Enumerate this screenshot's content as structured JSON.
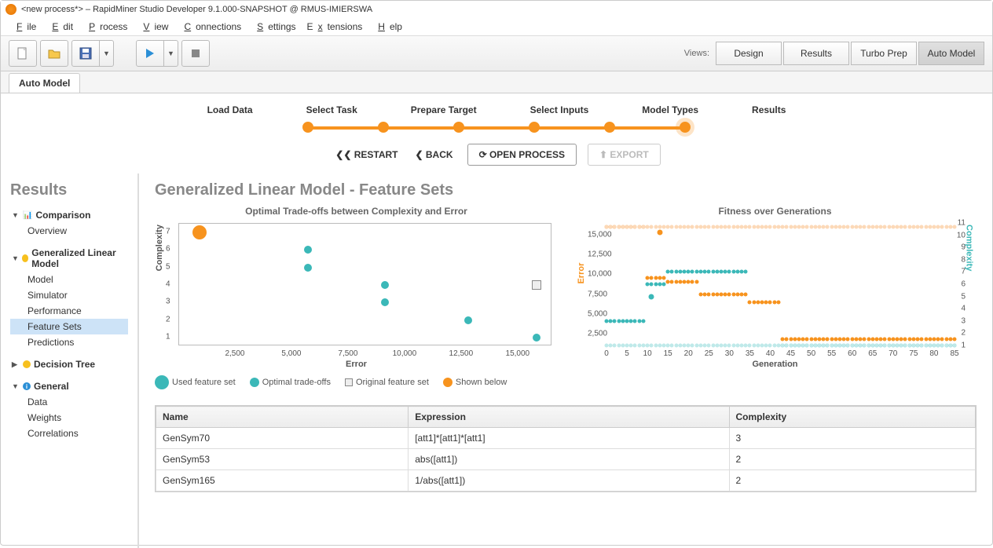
{
  "window": {
    "title": "<new process*> – RapidMiner Studio Developer 9.1.000-SNAPSHOT @ RMUS-IMIERSWA"
  },
  "menubar": {
    "items": [
      "File",
      "Edit",
      "Process",
      "View",
      "Connections",
      "Settings",
      "Extensions",
      "Help"
    ]
  },
  "views": {
    "label": "Views:",
    "buttons": [
      "Design",
      "Results",
      "Turbo Prep",
      "Auto Model"
    ],
    "active": 3
  },
  "tabs": {
    "active": "Auto Model"
  },
  "wizard": {
    "steps": [
      "Load Data",
      "Select Task",
      "Prepare Target",
      "Select Inputs",
      "Model Types",
      "Results"
    ],
    "controls": {
      "restart": "RESTART",
      "back": "BACK",
      "open": "OPEN PROCESS",
      "export": "EXPORT"
    }
  },
  "sidebar": {
    "title": "Results",
    "groups": [
      {
        "label": "Comparison",
        "icon": "compare",
        "children": [
          {
            "label": "Overview"
          }
        ]
      },
      {
        "label": "Generalized Linear Model",
        "icon": "bulb",
        "children": [
          {
            "label": "Model"
          },
          {
            "label": "Simulator"
          },
          {
            "label": "Performance"
          },
          {
            "label": "Feature Sets",
            "selected": true
          },
          {
            "label": "Predictions"
          }
        ]
      },
      {
        "label": "Decision Tree",
        "icon": "bulb",
        "expanded": false,
        "children": []
      },
      {
        "label": "General",
        "icon": "info",
        "children": [
          {
            "label": "Data"
          },
          {
            "label": "Weights"
          },
          {
            "label": "Correlations"
          }
        ]
      }
    ]
  },
  "main": {
    "heading": "Generalized Linear Model - Feature Sets",
    "chart1": {
      "title": "Optimal Trade-offs between Complexity and Error",
      "xlabel": "Error",
      "ylabel": "Complexity"
    },
    "chart2": {
      "title": "Fitness over Generations",
      "xlabel": "Generation",
      "y1label": "Error",
      "y2label": "Complexity"
    },
    "legend": {
      "used": "Used feature set",
      "optimal": "Optimal trade-offs",
      "original": "Original feature set",
      "shown": "Shown below"
    },
    "table": {
      "headers": [
        "Name",
        "Expression",
        "Complexity"
      ],
      "rows": [
        {
          "name": "GenSym70",
          "expr": "[att1]*[att1]*[att1]",
          "cx": "3"
        },
        {
          "name": "GenSym53",
          "expr": "abs([att1])",
          "cx": "2"
        },
        {
          "name": "GenSym165",
          "expr": "1/abs([att1])",
          "cx": "2"
        }
      ]
    }
  },
  "chart_data": [
    {
      "type": "scatter",
      "title": "Optimal Trade-offs between Complexity and Error",
      "xlabel": "Error",
      "ylabel": "Complexity",
      "xlim": [
        0,
        16500
      ],
      "ylim": [
        0.5,
        7.5
      ],
      "xticks": [
        2500,
        5000,
        7500,
        10000,
        12500,
        15000
      ],
      "yticks": [
        1,
        2,
        3,
        4,
        5,
        6,
        7
      ],
      "series": [
        {
          "name": "Used feature set",
          "color": "#f7931e",
          "points": [
            {
              "x": 900,
              "y": 7
            }
          ]
        },
        {
          "name": "Optimal trade-offs",
          "color": "#3bb8b8",
          "points": [
            {
              "x": 5700,
              "y": 6
            },
            {
              "x": 5700,
              "y": 5
            },
            {
              "x": 9100,
              "y": 4
            },
            {
              "x": 9100,
              "y": 3
            },
            {
              "x": 12800,
              "y": 2
            },
            {
              "x": 15800,
              "y": 1
            }
          ]
        },
        {
          "name": "Original feature set",
          "color": "#eee",
          "marker": "square",
          "points": [
            {
              "x": 15800,
              "y": 4
            }
          ]
        }
      ]
    },
    {
      "type": "scatter",
      "title": "Fitness over Generations",
      "xlabel": "Generation",
      "y1label": "Error",
      "y2label": "Complexity",
      "xlim": [
        0,
        85
      ],
      "y1lim": [
        1000,
        16500
      ],
      "y2lim": [
        1,
        11
      ],
      "xticks": [
        0,
        5,
        10,
        15,
        20,
        25,
        30,
        35,
        40,
        45,
        50,
        55,
        60,
        65,
        70,
        75,
        80,
        85
      ],
      "y1ticks": [
        2500,
        5000,
        7500,
        10000,
        12500,
        15000
      ],
      "y2ticks": [
        1,
        2,
        3,
        4,
        5,
        6,
        7,
        8,
        9,
        10,
        11
      ],
      "series": [
        {
          "name": "error_main",
          "axis": "y1",
          "color": "#f7931e",
          "segments": [
            {
              "g": [
                0,
                9
              ],
              "v": 16000
            },
            {
              "g": [
                10,
                14
              ],
              "v": 9500
            },
            {
              "g": [
                15,
                22
              ],
              "v": 9000
            },
            {
              "g": [
                23,
                34
              ],
              "v": 7500
            },
            {
              "g": [
                35,
                42
              ],
              "v": 6500
            },
            {
              "g": [
                43,
                85
              ],
              "v": 1800
            }
          ]
        },
        {
          "name": "error_outlier",
          "axis": "y1",
          "color": "#f7931e",
          "points": [
            {
              "x": 13,
              "y": 15300
            }
          ]
        },
        {
          "name": "complexity_main",
          "axis": "y2",
          "color": "#3bb8b8",
          "segments": [
            {
              "g": [
                0,
                9
              ],
              "v": 3
            },
            {
              "g": [
                10,
                14
              ],
              "v": 6
            },
            {
              "g": [
                15,
                34
              ],
              "v": 7
            },
            {
              "g": [
                43,
                85
              ],
              "v": 1
            }
          ]
        },
        {
          "name": "complexity_spike",
          "axis": "y2",
          "color": "#3bb8b8",
          "points": [
            {
              "x": 11,
              "y": 5
            }
          ]
        },
        {
          "name": "error_light",
          "axis": "y1",
          "color": "#fcd9b8",
          "segments": [
            {
              "g": [
                0,
                85
              ],
              "v": 16000
            }
          ]
        },
        {
          "name": "complexity_light",
          "axis": "y2",
          "color": "#bfe9e9",
          "segments": [
            {
              "g": [
                0,
                85
              ],
              "v": 1
            }
          ]
        }
      ]
    }
  ]
}
